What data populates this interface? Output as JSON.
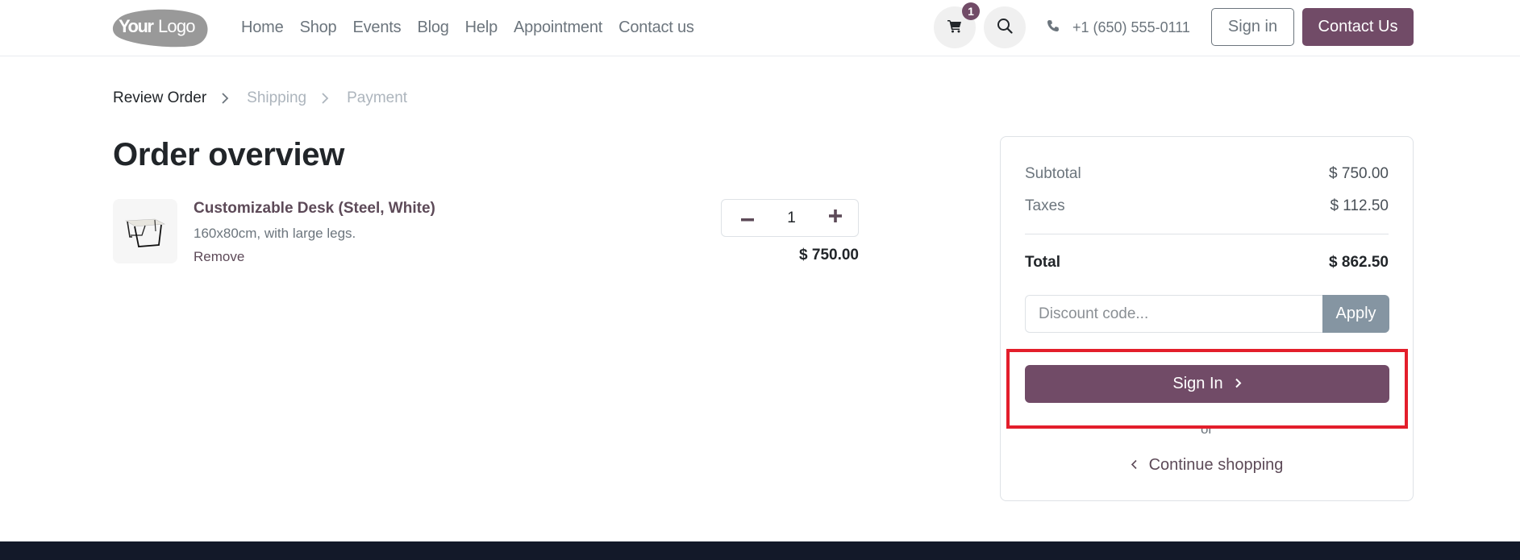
{
  "header": {
    "logo_text_bold": "Your",
    "logo_text_light": "Logo",
    "nav": [
      "Home",
      "Shop",
      "Events",
      "Blog",
      "Help",
      "Appointment",
      "Contact us"
    ],
    "cart_count": "1",
    "phone": "+1 (650) 555-0111",
    "signin_label": "Sign in",
    "contact_label": "Contact Us",
    "icons": {
      "cart": "cart-icon",
      "search": "search-icon",
      "phone": "phone-icon"
    }
  },
  "steps": {
    "items": [
      "Review Order",
      "Shipping",
      "Payment"
    ],
    "active": "Review Order"
  },
  "page_title": "Order overview",
  "order": {
    "lines": [
      {
        "name": "Customizable Desk (Steel, White)",
        "description": "160x80cm, with large legs.",
        "remove_label": "Remove",
        "quantity": "1",
        "price": "$ 750.00"
      }
    ]
  },
  "summary": {
    "subtotal_label": "Subtotal",
    "subtotal_value": "$ 750.00",
    "taxes_label": "Taxes",
    "taxes_value": "$ 112.50",
    "total_label": "Total",
    "total_value": "$ 862.50",
    "discount_placeholder": "Discount code...",
    "apply_label": "Apply",
    "signin_button_label": "Sign In",
    "or_text": "or",
    "continue_label": "Continue shopping"
  },
  "colors": {
    "brand": "#714b67",
    "apply": "#8595a2",
    "highlight": "#e31e2b",
    "footer": "#131929"
  }
}
